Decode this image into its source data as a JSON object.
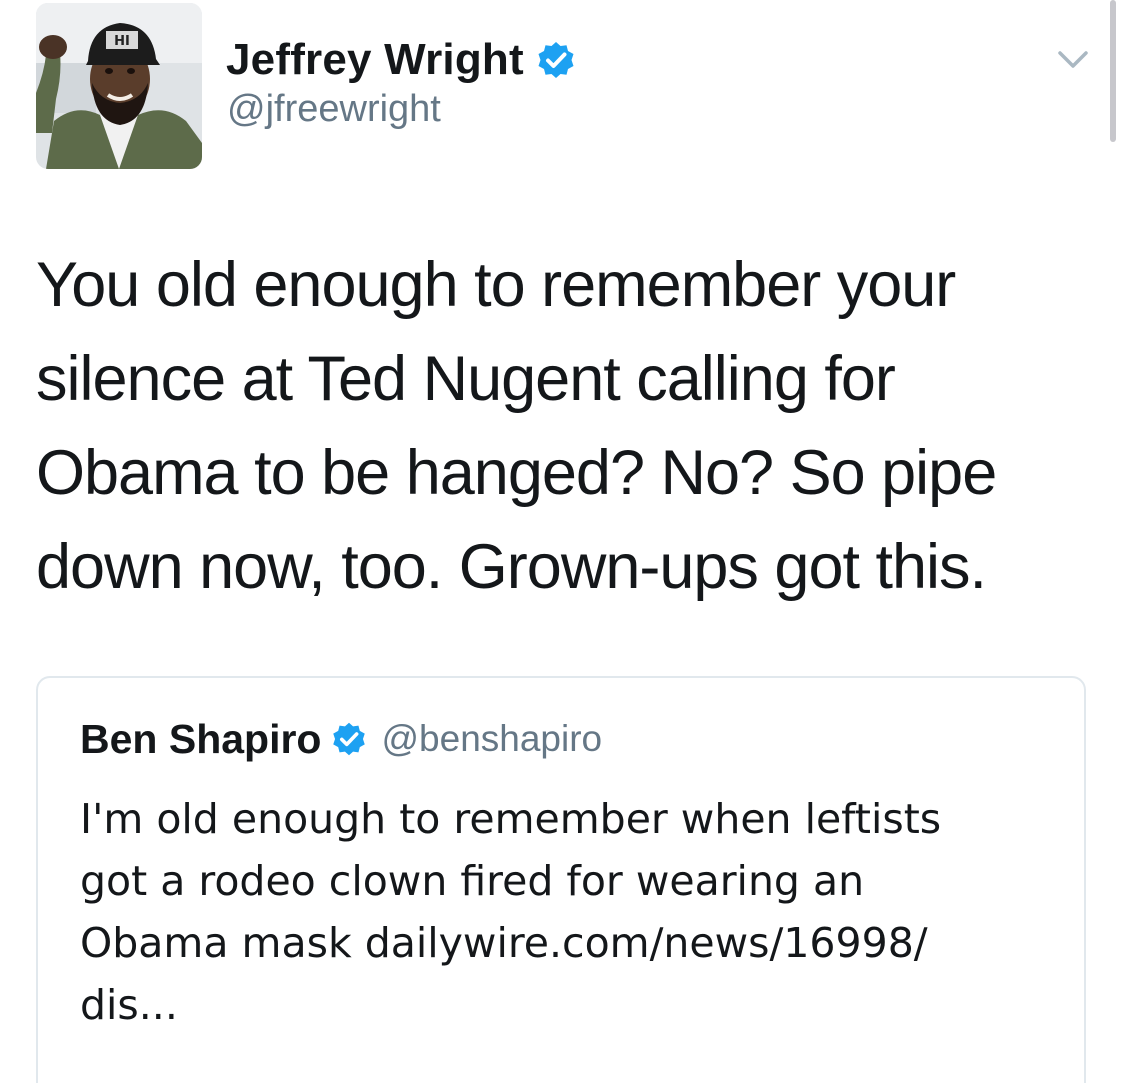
{
  "tweet": {
    "author": {
      "display_name": "Jeffrey Wright",
      "handle": "@jfreewright",
      "verified": true,
      "avatar_cap_text": "HI"
    },
    "text": "You old enough to remember your\nsilence at Ted Nugent calling for\nObama to be hanged? No? So pipe\ndown now, too. Grown-ups got this.",
    "menu_icon": "chevron-down-icon"
  },
  "quoted_tweet": {
    "author": {
      "display_name": "Ben Shapiro",
      "handle": "@benshapiro",
      "verified": true
    },
    "text": "I'm old enough to remember when leftists\ngot a rodeo clown fired for wearing an\nObama mask dailywire.com/news/16998/\ndis..."
  },
  "colors": {
    "text_primary": "#14171a",
    "text_secondary": "#657786",
    "verified_blue": "#1da1f2",
    "card_border": "#e1e8ed"
  }
}
